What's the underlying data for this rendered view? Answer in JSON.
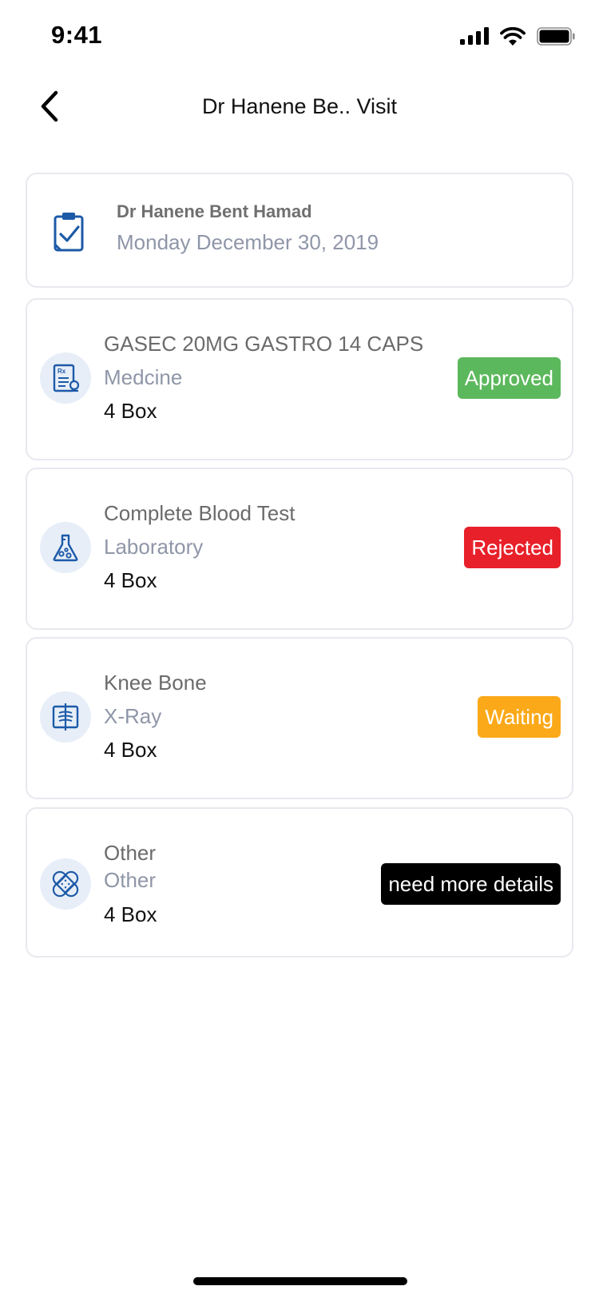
{
  "status_bar": {
    "time": "9:41"
  },
  "nav": {
    "title": "Dr Hanene Be.. Visit"
  },
  "visit": {
    "doctor": "Dr Hanene Bent Hamad",
    "date": "Monday December 30, 2019"
  },
  "items": [
    {
      "name": "GASEC 20MG GASTRO 14 CAPS",
      "type": "Medcine",
      "quantity": "4 Box",
      "status": "Approved",
      "status_color": "#5cb85c",
      "icon": "prescription-icon"
    },
    {
      "name": "Complete Blood Test",
      "type": "Laboratory",
      "quantity": "4 Box",
      "status": "Rejected",
      "status_color": "#e8202a",
      "icon": "lab-flask-icon"
    },
    {
      "name": "Knee Bone",
      "type": "X-Ray",
      "quantity": "4 Box",
      "status": "Waiting",
      "status_color": "#fba919",
      "icon": "xray-icon"
    },
    {
      "name": "Other",
      "type": "Other",
      "quantity": "4 Box",
      "status": "need more details",
      "status_color": "#000000",
      "icon": "bandage-icon"
    }
  ],
  "colors": {
    "icon_blue": "#1d5aa8",
    "icon_bg": "#e7eef8",
    "border": "#e7e9ee"
  }
}
